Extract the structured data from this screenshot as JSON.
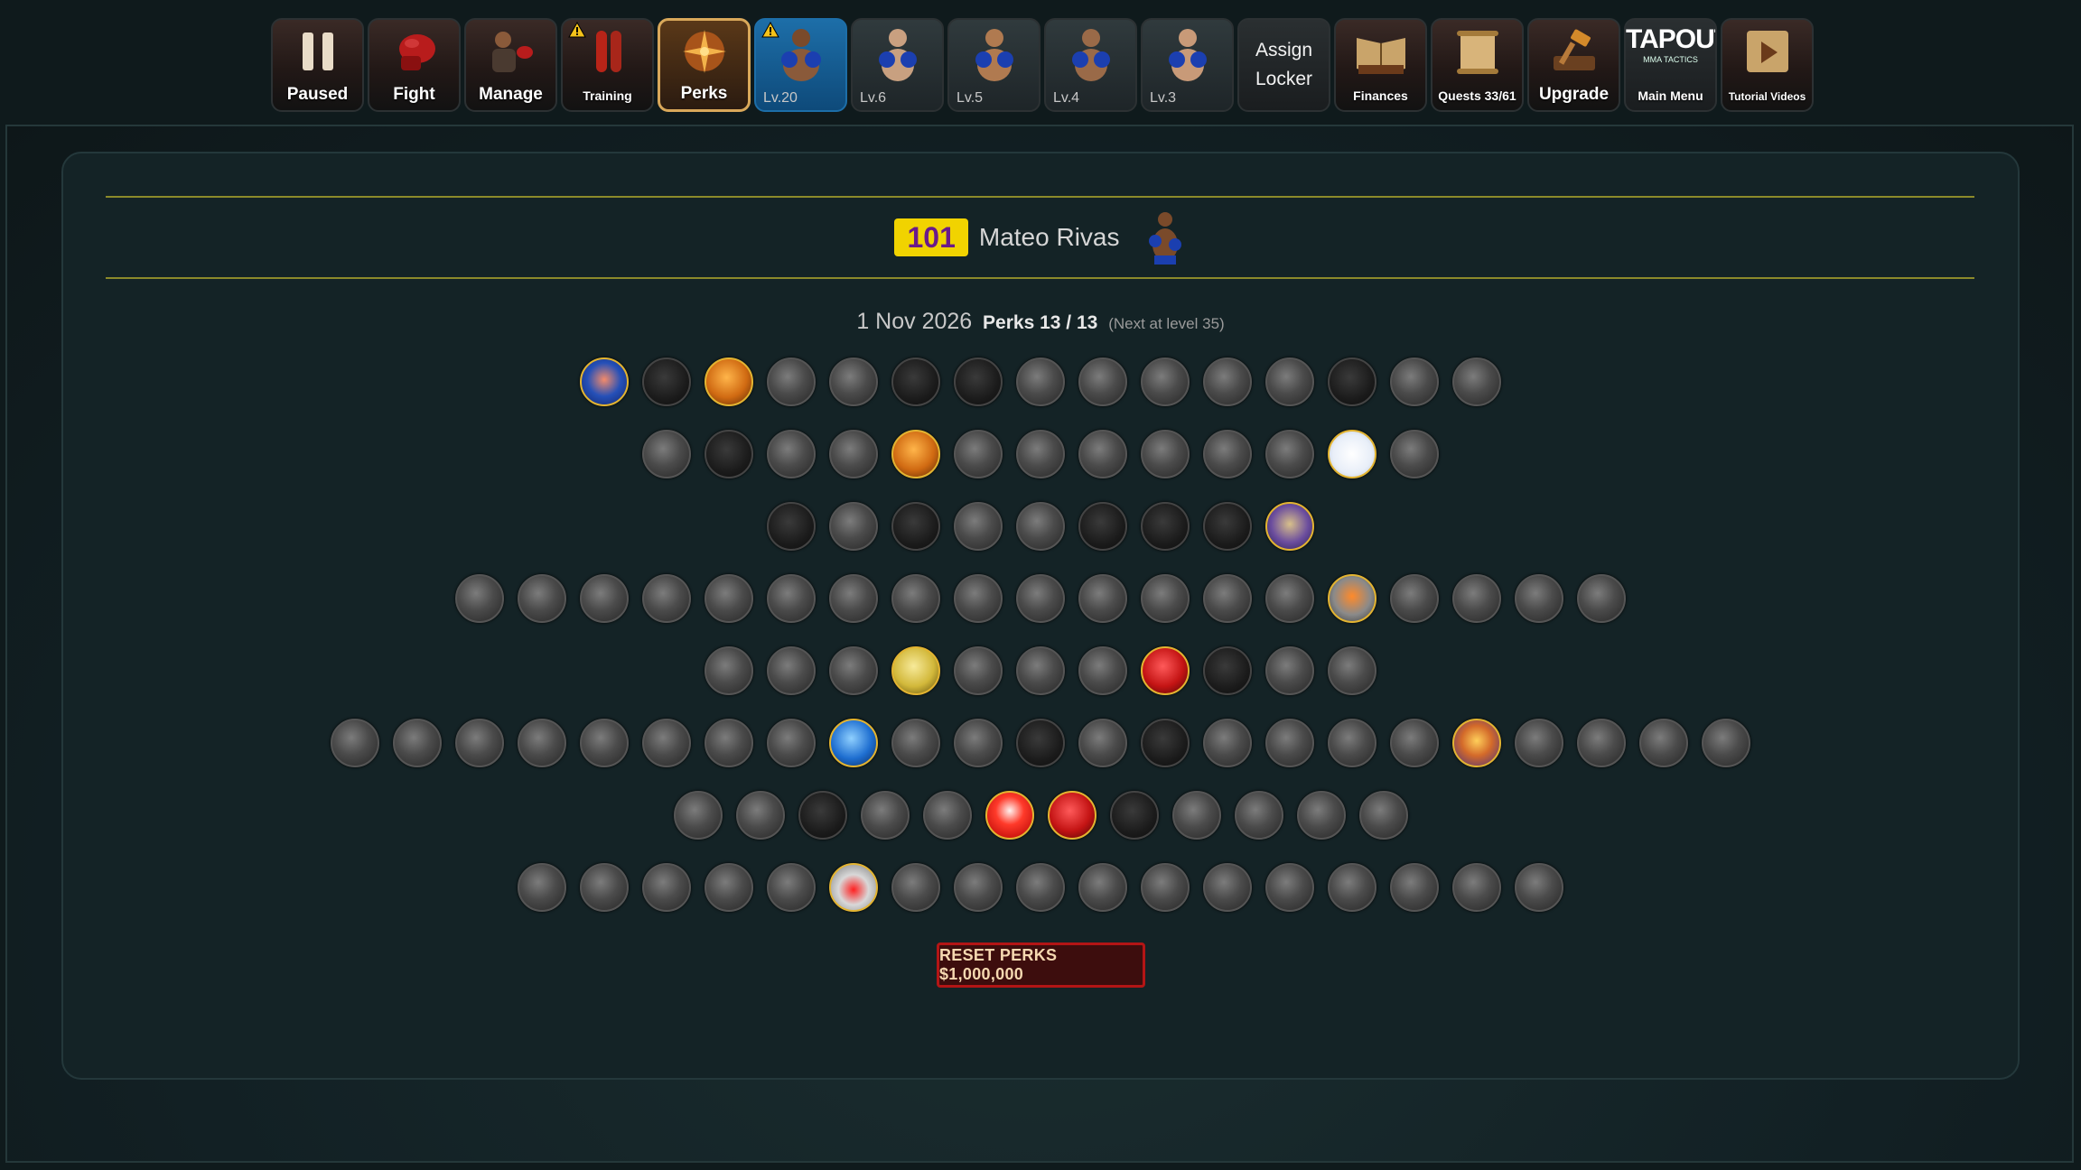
{
  "toolbar": {
    "paused_label": "Paused",
    "fight_label": "Fight",
    "manage_label": "Manage",
    "training_label": "Training",
    "perks_label": "Perks",
    "fighters": [
      {
        "level": "Lv.20"
      },
      {
        "level": "Lv.6"
      },
      {
        "level": "Lv.5"
      },
      {
        "level": "Lv.4"
      },
      {
        "level": "Lv.3"
      }
    ],
    "assign_line1": "Assign",
    "assign_line2": "Locker",
    "finances_label": "Finances",
    "quests_label": "Quests 33/61",
    "upgrade_label": "Upgrade",
    "logo_text": "TAPOUT",
    "logo_subtext": "MMA TACTICS",
    "main_menu_label": "Main Menu",
    "tutorial_label": "Tutorial Videos"
  },
  "fighter": {
    "level": "101",
    "name": "Mateo Rivas"
  },
  "perks_info": {
    "date": "1 Nov 2026",
    "perks_word": "Perks",
    "used": "13",
    "separator": "/",
    "total": "13",
    "next": "(Next at level 35)"
  },
  "perk_rows": [
    [
      "blue",
      "dk",
      "gold",
      "n",
      "n",
      "dk",
      "dk",
      "n",
      "n",
      "n",
      "n",
      "n",
      "dk",
      "n",
      "n"
    ],
    [
      "n",
      "dk",
      "n",
      "n",
      "gold",
      "n",
      "n",
      "n",
      "n",
      "n",
      "n",
      "chart",
      "n"
    ],
    [
      "dk",
      "n",
      "dk",
      "n",
      "n",
      "dk",
      "dk",
      "dk",
      "fighter-p"
    ],
    [
      "n",
      "n",
      "n",
      "n",
      "n",
      "n",
      "n",
      "n",
      "n",
      "n",
      "n",
      "n",
      "n",
      "n",
      "orangefig",
      "n",
      "n",
      "n",
      "n"
    ],
    [
      "n",
      "n",
      "n",
      "goldball",
      "n",
      "n",
      "n",
      "red",
      "dk",
      "n",
      "n"
    ],
    [
      "n",
      "n",
      "n",
      "n",
      "n",
      "n",
      "n",
      "n",
      "blue2",
      "n",
      "n",
      "dk",
      "n",
      "dk",
      "n",
      "n",
      "n",
      "n",
      "mixf",
      "n",
      "n",
      "n",
      "n"
    ],
    [
      "n",
      "n",
      "dk",
      "n",
      "n",
      "redwhite",
      "red",
      "dk",
      "n",
      "n",
      "n",
      "n"
    ],
    [
      "n",
      "n",
      "n",
      "n",
      "n",
      "drop",
      "n",
      "n",
      "n",
      "n",
      "n",
      "n",
      "n",
      "n",
      "n",
      "n",
      "n"
    ]
  ],
  "reset_button": "RESET PERKS $1,000,000",
  "colors": {
    "badge_bg": "#f1d300",
    "accent_gold": "#e3b431",
    "reset_border": "#b31515",
    "active_fighter": "#1d6ea8"
  }
}
